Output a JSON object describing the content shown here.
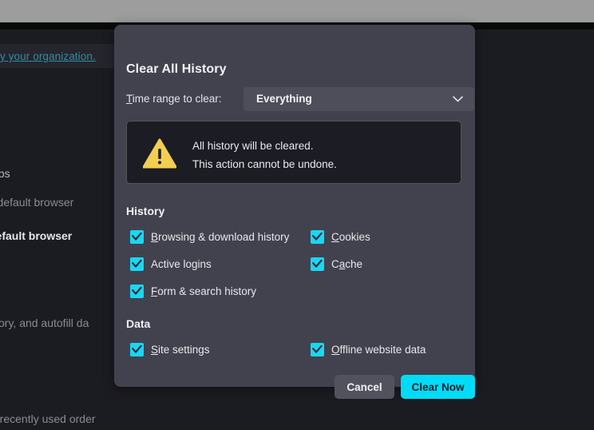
{
  "background": {
    "notice_link": "y your organization.",
    "lines": [
      {
        "text": "abs",
        "style": "normal"
      },
      {
        "text": "r default browser",
        "style": "dim"
      },
      {
        "text": "default browser",
        "style": "bold"
      },
      {
        "text": "istory, and autofill da",
        "style": "dim"
      },
      {
        "text": "n recently used order",
        "style": "dim"
      }
    ]
  },
  "dialog": {
    "title": "Clear All History",
    "time_range": {
      "label_prefix": "T",
      "label_rest": "ime range to clear:",
      "selected": "Everything",
      "chevron_icon": "chevron-down-icon"
    },
    "warning": {
      "icon": "warning-triangle-icon",
      "line1": "All history will be cleared.",
      "line2": "This action cannot be undone."
    },
    "sections": [
      {
        "title": "History",
        "items": [
          {
            "pre": "B",
            "key": "",
            "post": "rowsing & download history",
            "checked": true,
            "akpos": "first"
          },
          {
            "pre": "Active lo",
            "key": "g",
            "post": "ins",
            "checked": true,
            "akpos": "mid"
          },
          {
            "pre": "F",
            "key": "",
            "post": "orm & search history",
            "checked": true,
            "akpos": "first"
          },
          {
            "pre": "C",
            "key": "",
            "post": "ookies",
            "checked": true,
            "akpos": "first"
          },
          {
            "pre": "C",
            "key": "a",
            "post": "che",
            "checked": true,
            "akpos": "mid2"
          },
          {
            "pre": "S",
            "key": "",
            "post": "ite settings",
            "checked": true,
            "akpos": "first"
          },
          {
            "pre": "O",
            "key": "",
            "post": "ffline website data",
            "checked": true,
            "akpos": "first"
          }
        ]
      },
      {
        "title": "Data"
      }
    ],
    "labels": {
      "browsing": {
        "ak": "B",
        "rest": "rowsing & download history"
      },
      "logins": {
        "head": "Active lo",
        "ak": "g",
        "rest": "ins"
      },
      "form": {
        "ak": "F",
        "rest": "orm & search history"
      },
      "cookies": {
        "ak": "C",
        "rest": "ookies"
      },
      "cache": {
        "head": "C",
        "ak": "a",
        "rest": "che"
      },
      "site": {
        "ak": "S",
        "rest": "ite settings"
      },
      "offline": {
        "ak": "O",
        "rest": "ffline website data"
      }
    },
    "section_history_title": "History",
    "section_data_title": "Data",
    "buttons": {
      "cancel": "Cancel",
      "clear": "Clear Now"
    }
  },
  "colors": {
    "dialog_bg": "#42424f",
    "accent": "#00dcf8",
    "checkbox": "#19d7f2",
    "warning_yellow": "#f3ce51",
    "link": "#2d8fa5"
  }
}
